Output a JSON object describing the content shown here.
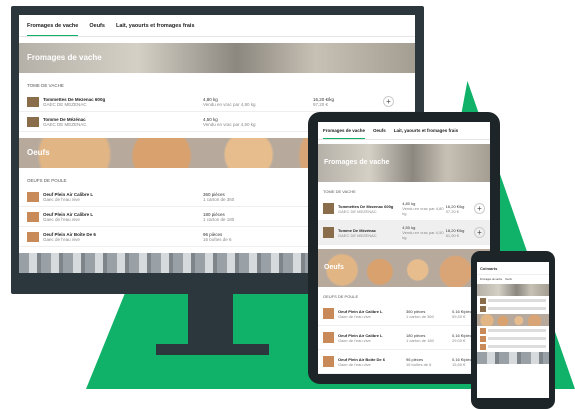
{
  "tabs": [
    "Fromages de vache",
    "Oeufs",
    "Lait, yaourts et fromages frais"
  ],
  "sections": [
    {
      "title": "Fromages de vache",
      "groups": [
        {
          "label": "TOME DE VACHE",
          "products": [
            {
              "name": "Tommettes De Mezenac 600g",
              "seller": "GAEC DE MEZENAC",
              "qty": "4,80 kg",
              "qty_note": "Vendu en vrac par 4,80 kg",
              "unit_price": "16,20 €/kg",
              "price": "97,20 €"
            },
            {
              "name": "Tomme De Mézénac",
              "seller": "GAEC DE MEZENAC",
              "qty": "4,50 kg",
              "qty_note": "Vendu en vrac par 4,50 kg",
              "unit_price": "18,20 €/kg",
              "price": "81,90 €"
            }
          ]
        }
      ]
    },
    {
      "title": "Oeufs",
      "groups": [
        {
          "label": "OEUFS DE POULE",
          "products": [
            {
              "name": "Oeuf Plein Air Calibre L",
              "seller": "Gaec de l'eau vive",
              "qty": "360 pièces",
              "qty_note": "1 carton de 360",
              "unit_price": "0,16 €/pièce",
              "price": "59,40 €"
            },
            {
              "name": "Oeuf Plein Air Calibre L",
              "seller": "Gaec de l'eau vive",
              "qty": "180 pièces",
              "qty_note": "1 carton de 180",
              "unit_price": "0,16 €/pièce",
              "price": "29,00 €"
            },
            {
              "name": "Oeuf Plein Air Boîte De 6",
              "seller": "Gaec de l'eau vive",
              "qty": "96 pièces",
              "qty_note": "16 boîtes de 6",
              "unit_price": "0,16 €/pièce",
              "price": "15,60 €"
            }
          ]
        }
      ]
    }
  ],
  "tablet": {
    "products": [
      {
        "name": "Tommettes De Mezenac 600g",
        "seller": "GAEC DE MEZENAC",
        "qty": "4,80 kg",
        "qty_note": "Vendu en vrac par 4,80 kg",
        "unit_price": "16,20 €/kg",
        "price": "97,20 €"
      },
      {
        "name": "Tomme De Mézénac",
        "seller": "GAEC DE MEZENAC",
        "qty": "4,50 kg",
        "qty_note": "Vendu en vrac par 4,50 kg",
        "unit_price": "18,20 €/kg",
        "price": "81,90 €"
      }
    ],
    "egg_products": [
      {
        "name": "Oeuf Plein Air Calibre L",
        "seller": "Gaec de l'eau vive",
        "qty": "360 pièces",
        "qty_note": "1 carton de 360",
        "unit_price": "0,16 €/pièce",
        "price": "59,40 €"
      },
      {
        "name": "Oeuf Plein Air Calibre L",
        "seller": "Gaec de l'eau vive",
        "qty": "180 pièces",
        "qty_note": "1 carton de 180",
        "unit_price": "0,16 €/pièce",
        "price": "29,00 €"
      },
      {
        "name": "Oeuf Plein Air Boîte De 6",
        "seller": "Gaec de l'eau vive",
        "qty": "96 pièces",
        "qty_note": "16 boîtes de 6",
        "unit_price": "0,16 €/pièce",
        "price": "15,60 €"
      }
    ]
  },
  "phone": {
    "title": "Colmarts"
  },
  "icons": {
    "add": "plus-icon"
  },
  "colors": {
    "accent": "#10b168",
    "device": "#2b363d"
  }
}
